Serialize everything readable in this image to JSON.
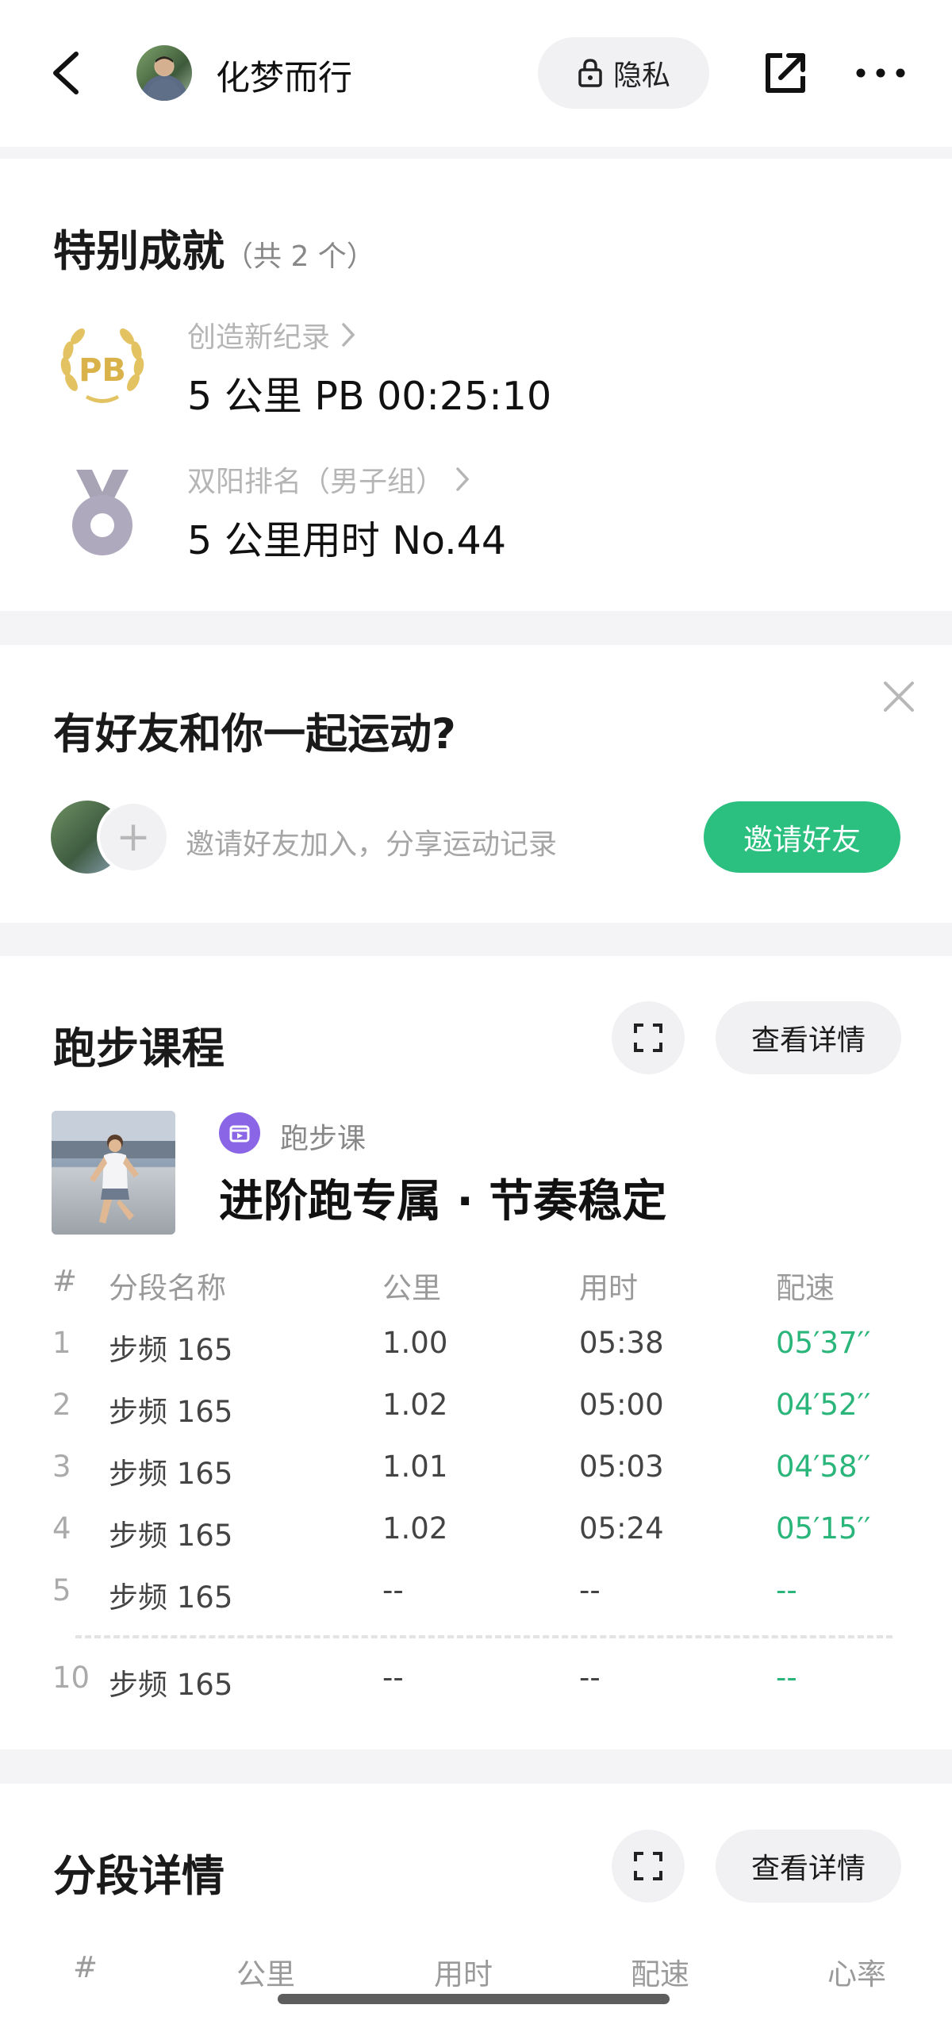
{
  "header": {
    "username": "化梦而行",
    "privacy_label": "隐私"
  },
  "achievements": {
    "title": "特别成就",
    "count_text": "（共 2 个）",
    "items": [
      {
        "label": "创造新纪录",
        "value": "5 公里 PB 00:25:10",
        "icon": "pb-laurel-badge-icon"
      },
      {
        "label": "双阳排名（男子组）",
        "value": "5 公里用时 No.44",
        "icon": "silver-medal-icon"
      }
    ]
  },
  "friends": {
    "title": "有好友和你一起运动?",
    "hint": "邀请好友加入，分享运动记录",
    "invite_button": "邀请好友"
  },
  "course": {
    "title": "跑步课程",
    "detail_button": "查看详情",
    "tag": "跑步课",
    "name": "进阶跑专属 · 节奏稳定",
    "columns": [
      "#",
      "分段名称",
      "公里",
      "用时",
      "配速"
    ],
    "rows": [
      {
        "n": "1",
        "name": "步频 165",
        "km": "1.00",
        "time": "05:38",
        "pace": "05′37′′"
      },
      {
        "n": "2",
        "name": "步频 165",
        "km": "1.02",
        "time": "05:00",
        "pace": "04′52′′"
      },
      {
        "n": "3",
        "name": "步频 165",
        "km": "1.01",
        "time": "05:03",
        "pace": "04′58′′"
      },
      {
        "n": "4",
        "name": "步频 165",
        "km": "1.02",
        "time": "05:24",
        "pace": "05′15′′"
      },
      {
        "n": "5",
        "name": "步频 165",
        "km": "--",
        "time": "--",
        "pace": "--"
      }
    ],
    "last_row": {
      "n": "10",
      "name": "步频 165",
      "km": "--",
      "time": "--",
      "pace": "--"
    }
  },
  "splits": {
    "title": "分段详情",
    "detail_button": "查看详情",
    "columns": [
      "#",
      "公里",
      "用时",
      "配速",
      "心率"
    ]
  },
  "colors": {
    "accent_green": "#2cc080",
    "pace_green": "#2ab57a",
    "heart_red": "#e04848"
  }
}
